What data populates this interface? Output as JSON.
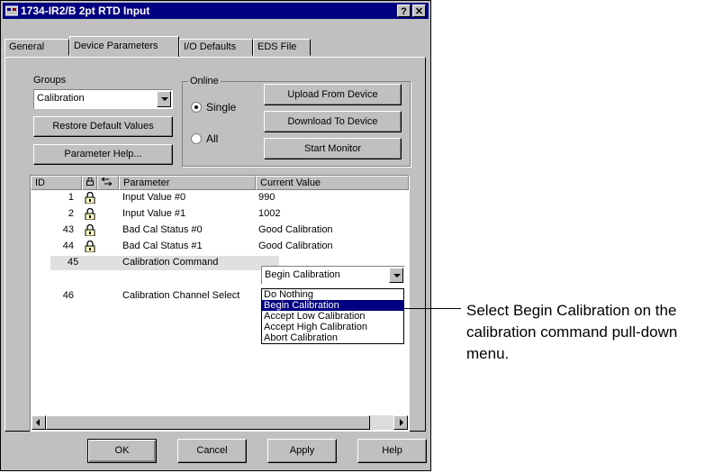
{
  "window": {
    "title": "1734-IR2/B 2pt RTD Input",
    "help_btn": "?",
    "close_btn": "✕"
  },
  "tabs": [
    {
      "label": "General"
    },
    {
      "label": "Device Parameters"
    },
    {
      "label": "I/O Defaults"
    },
    {
      "label": "EDS File"
    }
  ],
  "groups": {
    "label": "Groups",
    "value": "Calibration"
  },
  "buttons": {
    "restore": "Restore Default Values",
    "param_help": "Parameter Help...",
    "upload": "Upload From Device",
    "download": "Download To Device",
    "monitor": "Start Monitor",
    "ok": "OK",
    "cancel": "Cancel",
    "apply": "Apply",
    "help": "Help"
  },
  "online": {
    "label": "Online",
    "single": "Single",
    "all": "All",
    "selected": "Single"
  },
  "table": {
    "headers": {
      "id": "ID",
      "parameter": "Parameter",
      "value": "Current Value"
    },
    "rows": [
      {
        "id": "1",
        "parameter": "Input Value #0",
        "value": "990",
        "locked": true
      },
      {
        "id": "2",
        "parameter": "Input Value #1",
        "value": "1002",
        "locked": true
      },
      {
        "id": "43",
        "parameter": "Bad Cal Status #0",
        "value": "Good Calibration",
        "locked": true
      },
      {
        "id": "44",
        "parameter": "Bad Cal Status #1",
        "value": "Good Calibration",
        "locked": true
      },
      {
        "id": "45",
        "parameter": "Calibration Command",
        "value": "Begin Calibration",
        "locked": false
      },
      {
        "id": "46",
        "parameter": "Calibration Channel Select",
        "value": "",
        "locked": false
      }
    ]
  },
  "dropdown_options": [
    "Do Nothing",
    "Begin Calibration",
    "Accept Low Calibration",
    "Accept High Calibration",
    "Abort Calibration"
  ],
  "callout": "Select Begin Calibration on the calibration command pull-down menu."
}
